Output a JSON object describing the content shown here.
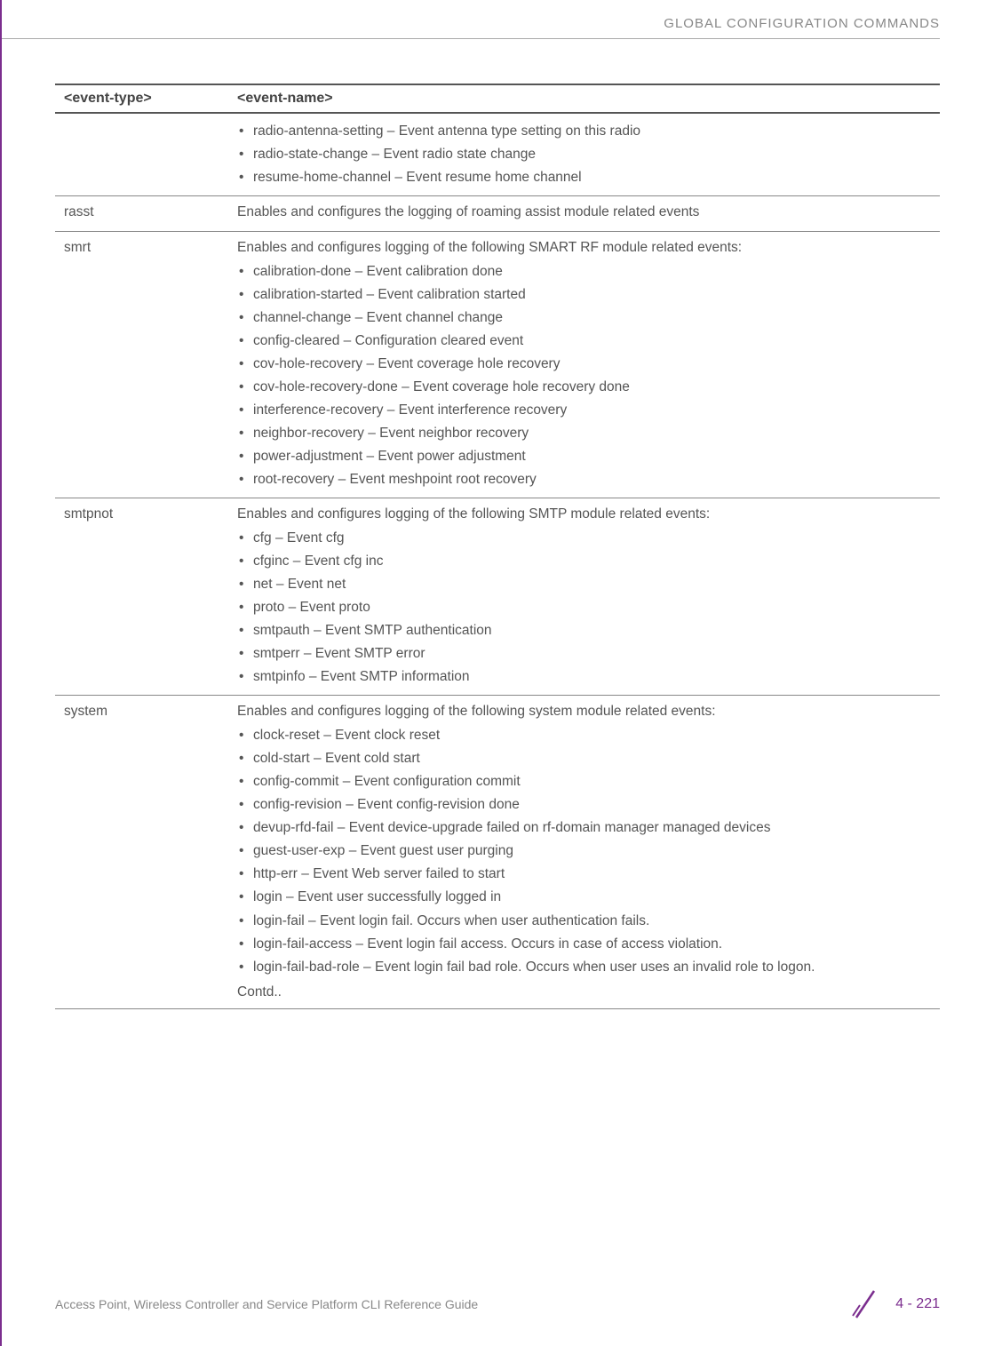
{
  "header": {
    "section_title": "GLOBAL CONFIGURATION COMMANDS"
  },
  "table": {
    "headers": {
      "col1": "<event-type>",
      "col2": "<event-name>"
    },
    "rows": [
      {
        "type": "",
        "desc": "",
        "items": [
          "radio-antenna-setting – Event antenna type setting on this radio",
          "radio-state-change – Event radio state change",
          "resume-home-channel – Event resume home channel"
        ]
      },
      {
        "type": "rasst",
        "desc": "Enables and configures the logging of roaming assist module related events",
        "items": []
      },
      {
        "type": "smrt",
        "desc": "Enables and configures logging of the following SMART RF module related events:",
        "items": [
          "calibration-done – Event calibration done",
          "calibration-started – Event calibration started",
          "channel-change – Event channel change",
          "config-cleared – Configuration cleared event",
          "cov-hole-recovery – Event coverage hole recovery",
          "cov-hole-recovery-done – Event coverage hole recovery done",
          "interference-recovery – Event interference recovery",
          "neighbor-recovery – Event neighbor recovery",
          "power-adjustment – Event power adjustment",
          "root-recovery – Event meshpoint root recovery"
        ]
      },
      {
        "type": "smtpnot",
        "desc": "Enables and configures logging of the following SMTP module related events:",
        "items": [
          "cfg – Event cfg",
          "cfginc – Event cfg inc",
          "net – Event net",
          "proto – Event proto",
          "smtpauth – Event SMTP authentication",
          "smtperr – Event SMTP error",
          "smtpinfo – Event SMTP information"
        ]
      },
      {
        "type": "system",
        "desc": "Enables and configures logging of the following system module related events:",
        "items": [
          "clock-reset – Event clock reset",
          "cold-start – Event cold start",
          "config-commit – Event configuration commit",
          "config-revision – Event config-revision done",
          "devup-rfd-fail – Event device-upgrade failed on rf-domain manager managed devices",
          "guest-user-exp – Event guest user purging",
          "http-err – Event Web server failed to start",
          "login – Event user successfully logged in",
          "login-fail – Event login fail. Occurs when user authentication fails.",
          "login-fail-access – Event login fail access. Occurs in case of access violation.",
          "login-fail-bad-role – Event login fail bad role. Occurs when user uses an invalid role to logon."
        ],
        "contd": "Contd.."
      }
    ]
  },
  "footer": {
    "left": "Access Point, Wireless Controller and Service Platform CLI Reference Guide",
    "page": "4 - 221"
  }
}
